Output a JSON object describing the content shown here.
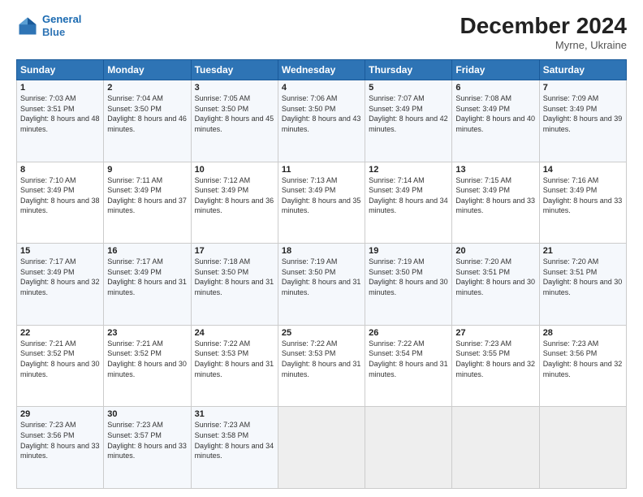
{
  "logo": {
    "line1": "General",
    "line2": "Blue"
  },
  "header": {
    "month": "December 2024",
    "location": "Myrne, Ukraine"
  },
  "weekdays": [
    "Sunday",
    "Monday",
    "Tuesday",
    "Wednesday",
    "Thursday",
    "Friday",
    "Saturday"
  ],
  "weeks": [
    [
      {
        "day": "1",
        "sunrise": "Sunrise: 7:03 AM",
        "sunset": "Sunset: 3:51 PM",
        "daylight": "Daylight: 8 hours and 48 minutes."
      },
      {
        "day": "2",
        "sunrise": "Sunrise: 7:04 AM",
        "sunset": "Sunset: 3:50 PM",
        "daylight": "Daylight: 8 hours and 46 minutes."
      },
      {
        "day": "3",
        "sunrise": "Sunrise: 7:05 AM",
        "sunset": "Sunset: 3:50 PM",
        "daylight": "Daylight: 8 hours and 45 minutes."
      },
      {
        "day": "4",
        "sunrise": "Sunrise: 7:06 AM",
        "sunset": "Sunset: 3:50 PM",
        "daylight": "Daylight: 8 hours and 43 minutes."
      },
      {
        "day": "5",
        "sunrise": "Sunrise: 7:07 AM",
        "sunset": "Sunset: 3:49 PM",
        "daylight": "Daylight: 8 hours and 42 minutes."
      },
      {
        "day": "6",
        "sunrise": "Sunrise: 7:08 AM",
        "sunset": "Sunset: 3:49 PM",
        "daylight": "Daylight: 8 hours and 40 minutes."
      },
      {
        "day": "7",
        "sunrise": "Sunrise: 7:09 AM",
        "sunset": "Sunset: 3:49 PM",
        "daylight": "Daylight: 8 hours and 39 minutes."
      }
    ],
    [
      {
        "day": "8",
        "sunrise": "Sunrise: 7:10 AM",
        "sunset": "Sunset: 3:49 PM",
        "daylight": "Daylight: 8 hours and 38 minutes."
      },
      {
        "day": "9",
        "sunrise": "Sunrise: 7:11 AM",
        "sunset": "Sunset: 3:49 PM",
        "daylight": "Daylight: 8 hours and 37 minutes."
      },
      {
        "day": "10",
        "sunrise": "Sunrise: 7:12 AM",
        "sunset": "Sunset: 3:49 PM",
        "daylight": "Daylight: 8 hours and 36 minutes."
      },
      {
        "day": "11",
        "sunrise": "Sunrise: 7:13 AM",
        "sunset": "Sunset: 3:49 PM",
        "daylight": "Daylight: 8 hours and 35 minutes."
      },
      {
        "day": "12",
        "sunrise": "Sunrise: 7:14 AM",
        "sunset": "Sunset: 3:49 PM",
        "daylight": "Daylight: 8 hours and 34 minutes."
      },
      {
        "day": "13",
        "sunrise": "Sunrise: 7:15 AM",
        "sunset": "Sunset: 3:49 PM",
        "daylight": "Daylight: 8 hours and 33 minutes."
      },
      {
        "day": "14",
        "sunrise": "Sunrise: 7:16 AM",
        "sunset": "Sunset: 3:49 PM",
        "daylight": "Daylight: 8 hours and 33 minutes."
      }
    ],
    [
      {
        "day": "15",
        "sunrise": "Sunrise: 7:17 AM",
        "sunset": "Sunset: 3:49 PM",
        "daylight": "Daylight: 8 hours and 32 minutes."
      },
      {
        "day": "16",
        "sunrise": "Sunrise: 7:17 AM",
        "sunset": "Sunset: 3:49 PM",
        "daylight": "Daylight: 8 hours and 31 minutes."
      },
      {
        "day": "17",
        "sunrise": "Sunrise: 7:18 AM",
        "sunset": "Sunset: 3:50 PM",
        "daylight": "Daylight: 8 hours and 31 minutes."
      },
      {
        "day": "18",
        "sunrise": "Sunrise: 7:19 AM",
        "sunset": "Sunset: 3:50 PM",
        "daylight": "Daylight: 8 hours and 31 minutes."
      },
      {
        "day": "19",
        "sunrise": "Sunrise: 7:19 AM",
        "sunset": "Sunset: 3:50 PM",
        "daylight": "Daylight: 8 hours and 30 minutes."
      },
      {
        "day": "20",
        "sunrise": "Sunrise: 7:20 AM",
        "sunset": "Sunset: 3:51 PM",
        "daylight": "Daylight: 8 hours and 30 minutes."
      },
      {
        "day": "21",
        "sunrise": "Sunrise: 7:20 AM",
        "sunset": "Sunset: 3:51 PM",
        "daylight": "Daylight: 8 hours and 30 minutes."
      }
    ],
    [
      {
        "day": "22",
        "sunrise": "Sunrise: 7:21 AM",
        "sunset": "Sunset: 3:52 PM",
        "daylight": "Daylight: 8 hours and 30 minutes."
      },
      {
        "day": "23",
        "sunrise": "Sunrise: 7:21 AM",
        "sunset": "Sunset: 3:52 PM",
        "daylight": "Daylight: 8 hours and 30 minutes."
      },
      {
        "day": "24",
        "sunrise": "Sunrise: 7:22 AM",
        "sunset": "Sunset: 3:53 PM",
        "daylight": "Daylight: 8 hours and 31 minutes."
      },
      {
        "day": "25",
        "sunrise": "Sunrise: 7:22 AM",
        "sunset": "Sunset: 3:53 PM",
        "daylight": "Daylight: 8 hours and 31 minutes."
      },
      {
        "day": "26",
        "sunrise": "Sunrise: 7:22 AM",
        "sunset": "Sunset: 3:54 PM",
        "daylight": "Daylight: 8 hours and 31 minutes."
      },
      {
        "day": "27",
        "sunrise": "Sunrise: 7:23 AM",
        "sunset": "Sunset: 3:55 PM",
        "daylight": "Daylight: 8 hours and 32 minutes."
      },
      {
        "day": "28",
        "sunrise": "Sunrise: 7:23 AM",
        "sunset": "Sunset: 3:56 PM",
        "daylight": "Daylight: 8 hours and 32 minutes."
      }
    ],
    [
      {
        "day": "29",
        "sunrise": "Sunrise: 7:23 AM",
        "sunset": "Sunset: 3:56 PM",
        "daylight": "Daylight: 8 hours and 33 minutes."
      },
      {
        "day": "30",
        "sunrise": "Sunrise: 7:23 AM",
        "sunset": "Sunset: 3:57 PM",
        "daylight": "Daylight: 8 hours and 33 minutes."
      },
      {
        "day": "31",
        "sunrise": "Sunrise: 7:23 AM",
        "sunset": "Sunset: 3:58 PM",
        "daylight": "Daylight: 8 hours and 34 minutes."
      },
      null,
      null,
      null,
      null
    ]
  ]
}
